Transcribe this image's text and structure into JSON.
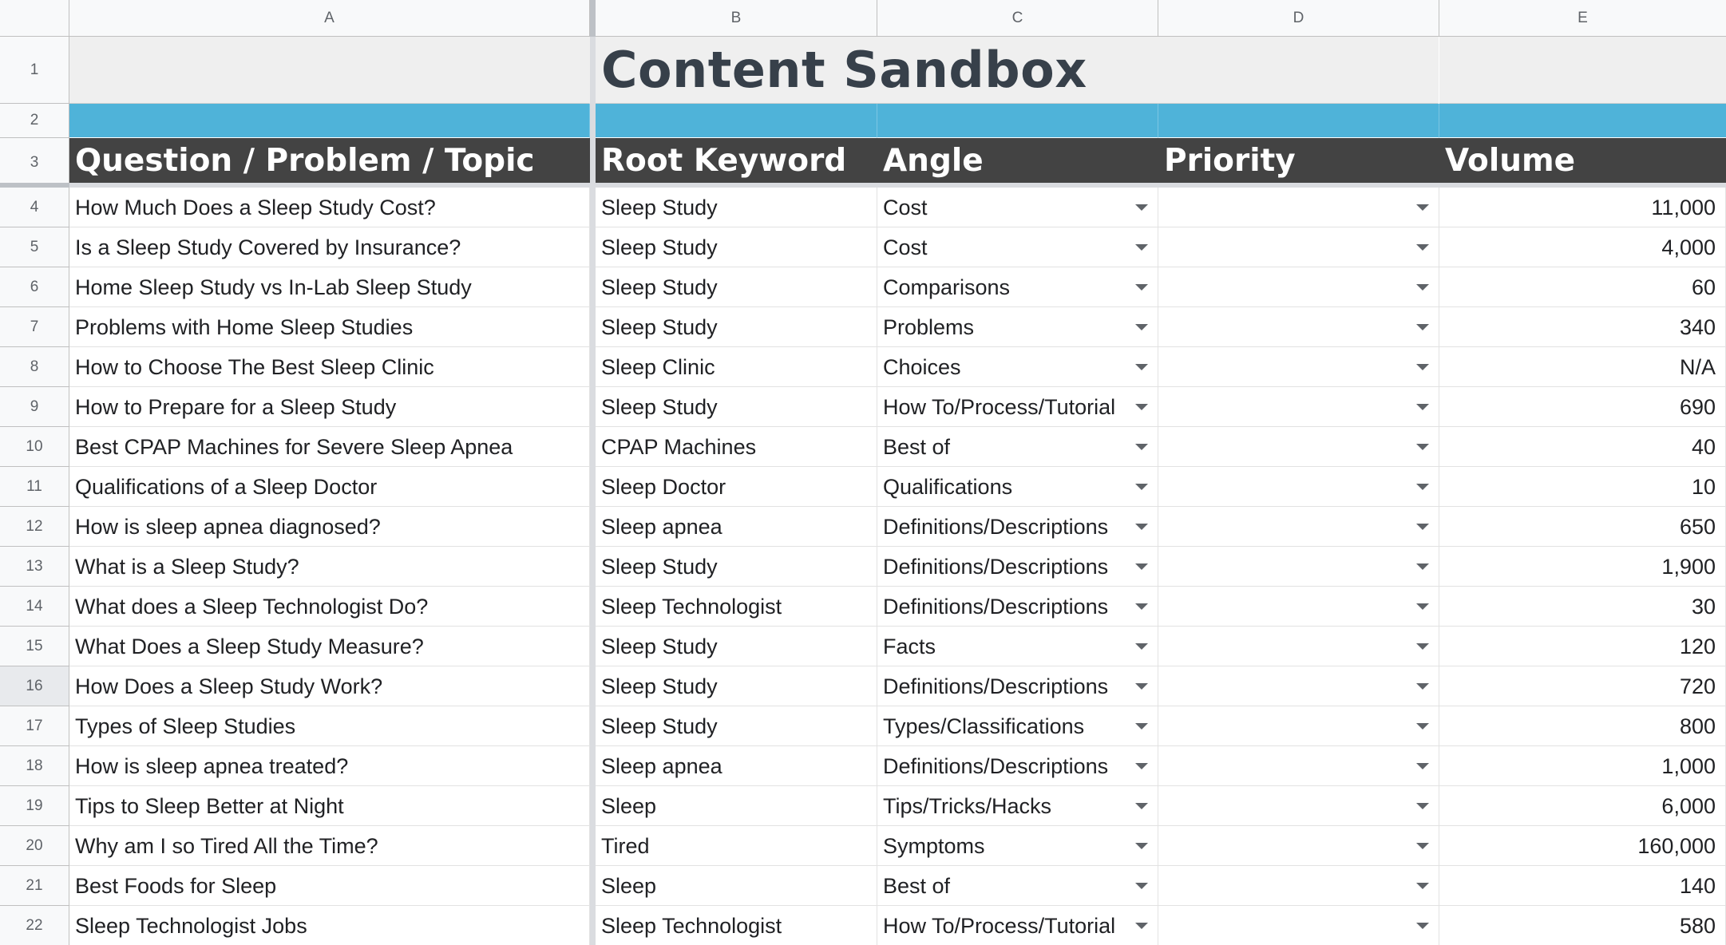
{
  "columns": [
    "A",
    "B",
    "C",
    "D",
    "E"
  ],
  "title": "Content Sandbox",
  "headers": {
    "topic": "Question / Problem / Topic",
    "root_keyword": "Root Keyword",
    "angle": "Angle",
    "priority": "Priority",
    "volume": "Volume"
  },
  "row_numbers": [
    "1",
    "2",
    "3",
    "4",
    "5",
    "6",
    "7",
    "8",
    "9",
    "10",
    "11",
    "12",
    "13",
    "14",
    "15",
    "16",
    "17",
    "18",
    "19",
    "20",
    "21",
    "22"
  ],
  "rows": [
    {
      "topic": "How Much Does a Sleep Study Cost?",
      "keyword": "Sleep Study",
      "angle": "Cost",
      "priority": "",
      "volume": "11,000"
    },
    {
      "topic": "Is a Sleep Study Covered by Insurance?",
      "keyword": "Sleep Study",
      "angle": "Cost",
      "priority": "",
      "volume": "4,000"
    },
    {
      "topic": "Home Sleep Study vs In-Lab Sleep Study",
      "keyword": "Sleep Study",
      "angle": "Comparisons",
      "priority": "",
      "volume": "60"
    },
    {
      "topic": "Problems with Home Sleep Studies",
      "keyword": "Sleep Study",
      "angle": "Problems",
      "priority": "",
      "volume": "340"
    },
    {
      "topic": "How to Choose The Best Sleep Clinic",
      "keyword": "Sleep Clinic",
      "angle": "Choices",
      "priority": "",
      "volume": "N/A"
    },
    {
      "topic": "How to Prepare for a Sleep Study",
      "keyword": "Sleep Study",
      "angle": "How To/Process/Tutorial",
      "priority": "",
      "volume": "690"
    },
    {
      "topic": "Best CPAP Machines for Severe Sleep Apnea",
      "keyword": "CPAP Machines",
      "angle": "Best of",
      "priority": "",
      "volume": "40"
    },
    {
      "topic": "Qualifications of a Sleep Doctor",
      "keyword": "Sleep Doctor",
      "angle": "Qualifications",
      "priority": "",
      "volume": "10"
    },
    {
      "topic": "How is sleep apnea diagnosed?",
      "keyword": "Sleep apnea",
      "angle": "Definitions/Descriptions",
      "priority": "",
      "volume": "650"
    },
    {
      "topic": "What is a Sleep Study?",
      "keyword": "Sleep Study",
      "angle": "Definitions/Descriptions",
      "priority": "",
      "volume": "1,900"
    },
    {
      "topic": "What does a Sleep Technologist Do?",
      "keyword": "Sleep Technologist",
      "angle": "Definitions/Descriptions",
      "priority": "",
      "volume": "30"
    },
    {
      "topic": "What Does a Sleep Study Measure?",
      "keyword": "Sleep Study",
      "angle": "Facts",
      "priority": "",
      "volume": "120"
    },
    {
      "topic": "How Does a Sleep Study Work?",
      "keyword": "Sleep Study",
      "angle": "Definitions/Descriptions",
      "priority": "",
      "volume": "720"
    },
    {
      "topic": "Types of Sleep Studies",
      "keyword": "Sleep Study",
      "angle": "Types/Classifications",
      "priority": "",
      "volume": "800"
    },
    {
      "topic": "How is sleep apnea treated?",
      "keyword": "Sleep apnea",
      "angle": "Definitions/Descriptions",
      "priority": "",
      "volume": "1,000"
    },
    {
      "topic": "Tips to Sleep Better at Night",
      "keyword": "Sleep",
      "angle": "Tips/Tricks/Hacks",
      "priority": "",
      "volume": "6,000"
    },
    {
      "topic": "Why am I so Tired All the Time?",
      "keyword": "Tired",
      "angle": "Symptoms",
      "priority": "",
      "volume": "160,000"
    },
    {
      "topic": "Best Foods for Sleep",
      "keyword": "Sleep",
      "angle": "Best of",
      "priority": "",
      "volume": "140"
    },
    {
      "topic": "Sleep Technologist Jobs",
      "keyword": "Sleep Technologist",
      "angle": "How To/Process/Tutorial",
      "priority": "",
      "volume": "580"
    }
  ],
  "colors": {
    "band": "#4fb3d9",
    "header_bg": "#434343",
    "title_bg": "#efefef",
    "title_text": "#37404a"
  }
}
